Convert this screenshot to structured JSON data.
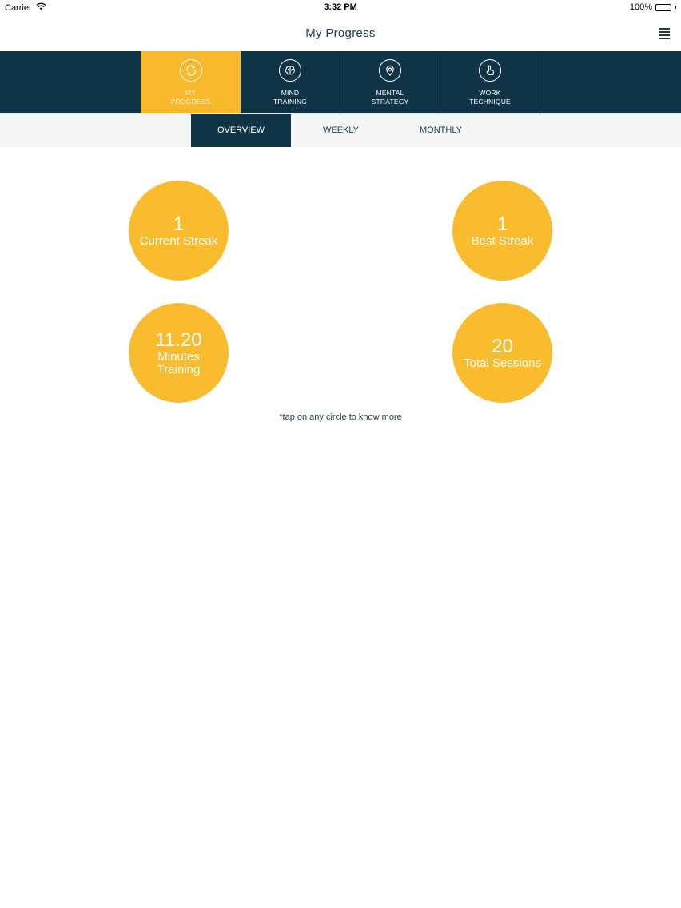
{
  "status_bar": {
    "carrier": "Carrier",
    "time": "3:32 PM",
    "battery": "100%",
    "battery_level": 1.0
  },
  "nav": {
    "title": "My Progress",
    "menu_icon": "hamburger-icon"
  },
  "colors": {
    "accent": "#f9bc2e",
    "navy": "#0e3446",
    "subbar_bg": "#f4f5f5"
  },
  "sections": [
    {
      "label": "MY PROGRESS",
      "icon": "refresh-icon",
      "active": true
    },
    {
      "label": "MIND TRAINING",
      "icon": "brain-icon",
      "active": false
    },
    {
      "label": "MENTAL STRATEGY",
      "icon": "location-pin-icon",
      "active": false
    },
    {
      "label": "WORK TECHNIQUE",
      "icon": "hand-pointer-icon",
      "active": false
    }
  ],
  "subtabs": [
    {
      "label": "OVERVIEW",
      "active": true
    },
    {
      "label": "WEEKLY",
      "active": false
    },
    {
      "label": "MONTHLY",
      "active": false
    }
  ],
  "stats": {
    "current_streak": {
      "value": "1",
      "label": "Current Streak"
    },
    "best_streak": {
      "value": "1",
      "label": "Best Streak"
    },
    "minutes_training": {
      "value": "11.20",
      "label": "Minutes Training"
    },
    "total_sessions": {
      "value": "20",
      "label": "Total Sessions"
    }
  },
  "hint": "*tap on any circle to know more"
}
